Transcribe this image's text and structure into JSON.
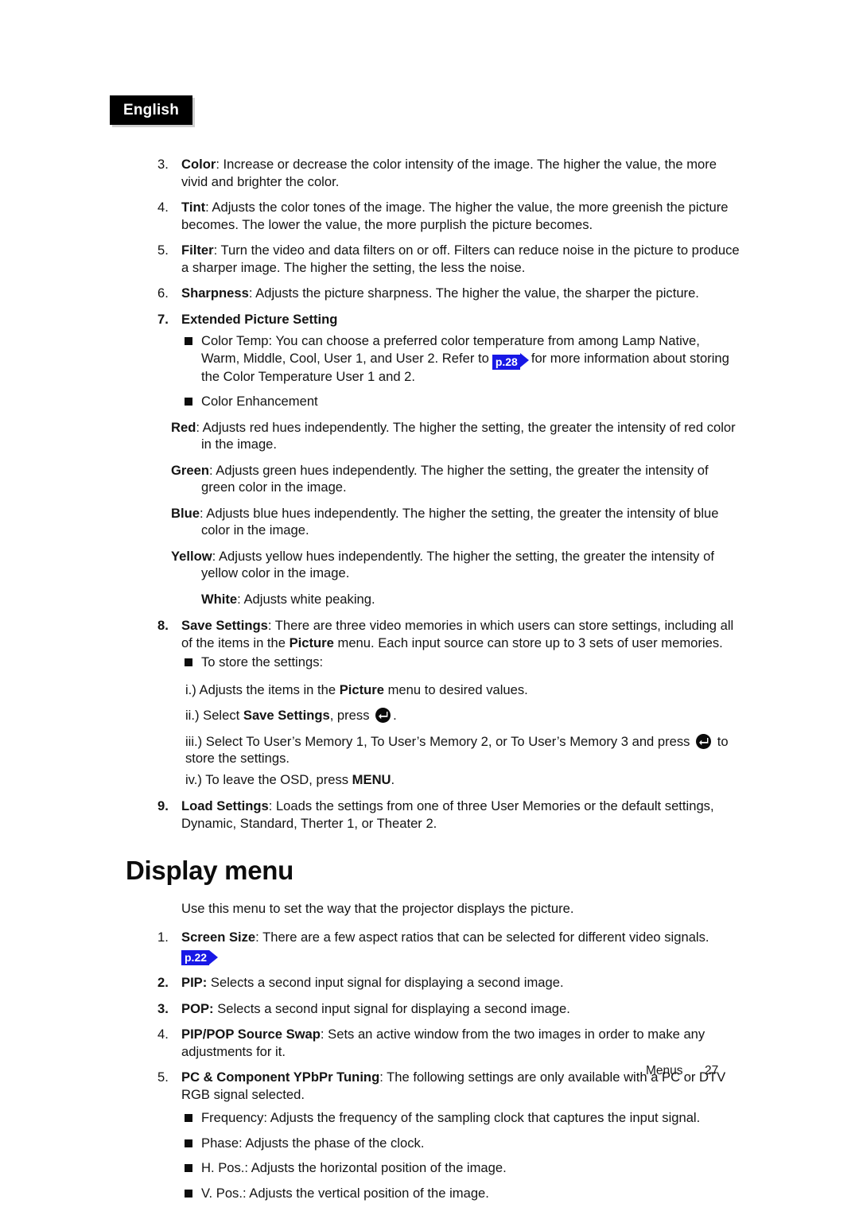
{
  "language_tab": {
    "label": "English"
  },
  "list_continued": [
    {
      "number": "3.",
      "bold_number": false,
      "term": "Color",
      "text": ": Increase or decrease the color intensity of the image. The higher the value, the more vivid and brighter the color."
    },
    {
      "number": "4.",
      "bold_number": false,
      "term": "Tint",
      "text": ": Adjusts the color tones of the image. The higher the value, the more greenish the picture becomes. The lower the value, the more purplish the picture becomes."
    },
    {
      "number": "5.",
      "bold_number": false,
      "term": "Filter",
      "text": ": Turn the video and data filters on or off. Filters can reduce noise in the picture to produce a sharper image. The higher the setting, the less the noise."
    },
    {
      "number": "6.",
      "bold_number": false,
      "term": "Sharpness",
      "text": ": Adjusts the picture sharpness. The higher the value, the sharper the picture."
    }
  ],
  "item7": {
    "number": "7.",
    "title": "Extended Picture Setting",
    "color_temp": {
      "text_before": "Color Temp: You can choose a preferred color temperature from among Lamp Native, Warm, Middle, Cool, User 1, and User 2. Refer to",
      "ref_badge": "p.28",
      "text_after": "for more information about storing the Color Temperature User 1 and 2."
    },
    "color_enhancement_label": "Color Enhancement",
    "channels": [
      {
        "term": "Red",
        "text": ": Adjusts red hues independently. The higher the setting, the greater the intensity of red color in the image."
      },
      {
        "term": "Green",
        "text": ": Adjusts green hues independently. The higher the setting, the greater the intensity of green color in the image."
      },
      {
        "term": "Blue",
        "text": ": Adjusts blue hues independently. The higher the setting, the greater the intensity of blue color in the image."
      },
      {
        "term": "Yellow",
        "text": ": Adjusts yellow hues independently. The higher the setting, the greater the intensity of yellow color in the image."
      },
      {
        "term": "White",
        "text": ": Adjusts white peaking."
      }
    ]
  },
  "item8": {
    "number": "8.",
    "term": "Save Settings",
    "text_a": ": There are three video memories in which users can store settings, including all of the items in the",
    "inline_bold": "Picture",
    "text_b": "menu. Each input source can store up to 3 sets of user memories.",
    "bullet": "To store the settings:",
    "steps": {
      "i_a": "i.) Adjusts the items in the",
      "i_bold": "Picture",
      "i_b": "menu to desired values.",
      "ii_a": "ii.) Select",
      "ii_bold": "Save Settings",
      "ii_b": ", press",
      "ii_c": ".",
      "iii_a": "iii.) Select To User’s Memory 1, To User’s Memory 2, or To User’s Memory 3 and press",
      "iii_b": "to store the settings.",
      "iv_a": "iv.) To leave the OSD, press",
      "iv_bold": "MENU",
      "iv_b": "."
    }
  },
  "item9": {
    "number": "9.",
    "term": "Load Settings",
    "text": ": Loads the settings from one of three User Memories or the default settings, Dynamic, Standard, Therter 1, or Theater 2."
  },
  "display_menu": {
    "heading": "Display menu",
    "intro": "Use this menu to set the way that the projector displays the picture.",
    "items": [
      {
        "number": "1.",
        "bold_number": false,
        "term": "Screen Size",
        "text": ": There are a few aspect ratios that can be selected for different video signals.",
        "ref_badge": "p.22"
      },
      {
        "number": "2.",
        "bold_number": true,
        "term": "PIP:",
        "text": " Selects a second input signal for displaying a second image."
      },
      {
        "number": "3.",
        "bold_number": true,
        "term": "POP:",
        "text": " Selects a second input signal for displaying a second image."
      },
      {
        "number": "4.",
        "bold_number": false,
        "term": "PIP/POP Source Swap",
        "text": ": Sets an active window from the two images in order to make any adjustments for it."
      },
      {
        "number": "5.",
        "bold_number": false,
        "term": "PC & Component YPbPr Tuning",
        "text": ": The following settings are only available with a PC or DTV RGB signal selected."
      }
    ],
    "tuning_bullets": [
      "Frequency: Adjusts the frequency of the sampling clock that captures the input signal.",
      "Phase: Adjusts the phase of the clock.",
      "H. Pos.: Adjusts the horizontal position of the image.",
      "V. Pos.: Adjusts the vertical position of the image."
    ]
  },
  "footer": {
    "label": "Menus",
    "page_number": "27"
  },
  "colors": {
    "ref_badge_blue": "#1818e6",
    "tab_black": "#000000",
    "body_text": "#141414"
  }
}
